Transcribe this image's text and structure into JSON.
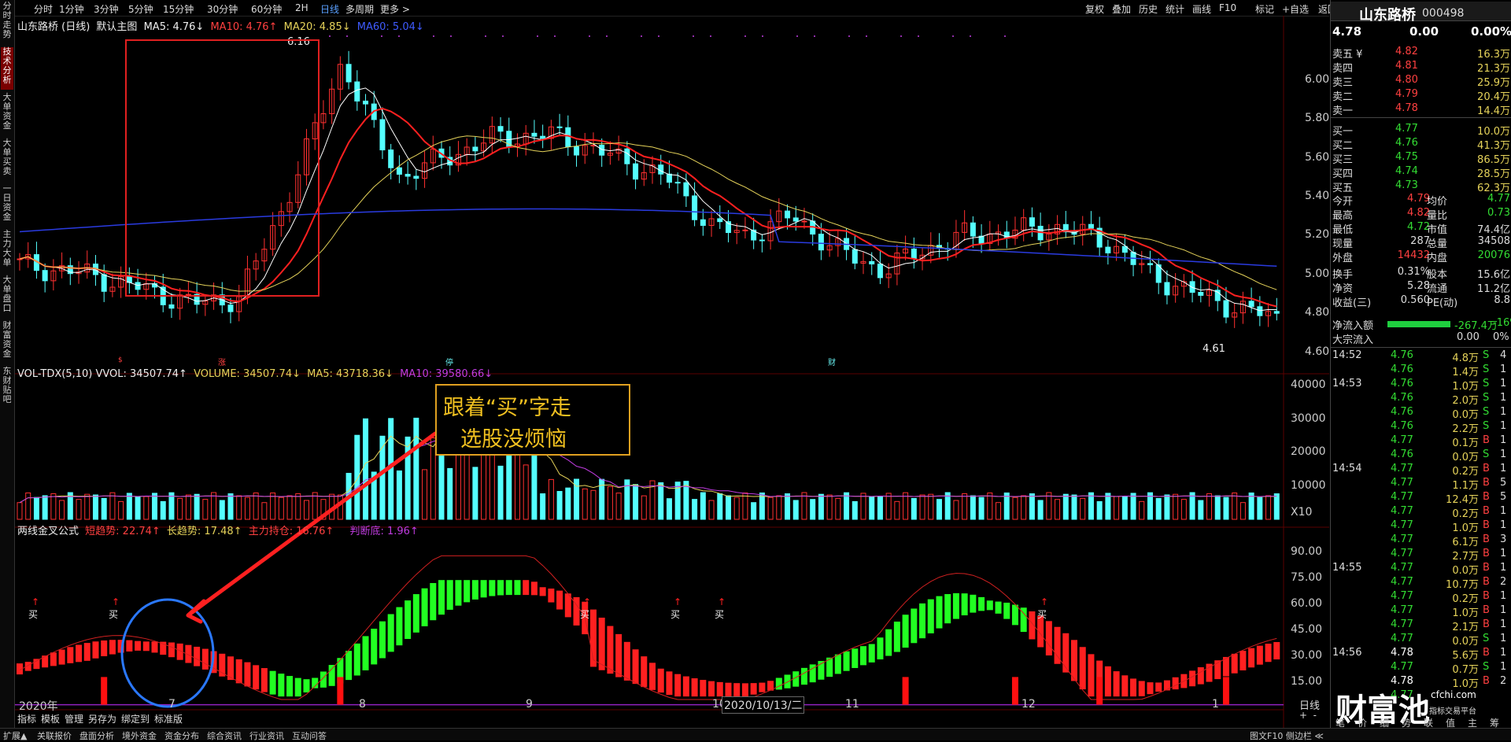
{
  "leftbar": [
    "分时走势",
    "技术分析",
    "大单资金",
    "大单买卖",
    "一日资金",
    "主力大单",
    "大单盘口",
    "财富资金",
    "东财贴吧"
  ],
  "toolbar_left": [
    "分时",
    "1分钟",
    "3分钟",
    "5分钟",
    "15分钟",
    "30分钟",
    "60分钟",
    "2H",
    "日线",
    "多周期",
    "更多 >"
  ],
  "toolbar_right": [
    "复权",
    "叠加",
    "历史",
    "统计",
    "画线",
    "F10",
    "标记",
    "+自选",
    "返回"
  ],
  "main_indicator": {
    "name": "山东路桥 (日线)",
    "preset": "默认主图",
    "ma5": "MA5: 4.76↓",
    "ma10": "MA10: 4.76↑",
    "ma20": "MA20: 4.85↓",
    "ma60": "MA60: 5.04↓"
  },
  "annotations": {
    "high": "6.16",
    "low": "4.61"
  },
  "event_marks": {
    "a": "$",
    "b": "涨",
    "c": "停",
    "d": "财"
  },
  "price_axis": [
    "6.00",
    "5.80",
    "5.60",
    "5.40",
    "5.20",
    "5.00",
    "4.80",
    "4.60"
  ],
  "vol_indicator": {
    "name": "VOL-TDX(5,10) VVOL: 34507.74↑",
    "volume": "VOLUME: 34507.74↓",
    "ma5": "MA5: 43718.36↓",
    "ma10": "MA10: 39580.66↓"
  },
  "vol_axis": [
    "40000",
    "30000",
    "20000",
    "10000",
    "X10"
  ],
  "promo_box": {
    "line1": "跟着“买”字走",
    "line2": "选股没烦恼"
  },
  "sub_indicator": {
    "name": "两线金叉公式",
    "short": "短趋势: 22.74↑",
    "long": "长趋势: 17.48↑",
    "main": "主力持仓: 16.76↑",
    "judge": "判断底: 1.96↑"
  },
  "sub_axis": [
    "90.00",
    "75.00",
    "60.00",
    "45.00",
    "30.00",
    "15.00"
  ],
  "buy_label": "买",
  "date_axis": [
    "2020年",
    "7",
    "8",
    "9",
    "10",
    "11",
    "12",
    "1"
  ],
  "cursor_date": "2020/10/13/二",
  "date_axis_right": "日线",
  "bottom_left": [
    "指标",
    "模板",
    "管理",
    "另存为",
    "绑定到",
    "标准版"
  ],
  "bottom_bar": [
    "扩展▲",
    "关联报价",
    "盘面分析",
    "境外资金",
    "资金分布",
    "综合资讯",
    "行业资讯",
    "互动问答"
  ],
  "bottom_right": "图文F10 侧边栏 ≪",
  "quote": {
    "name": "山东路桥",
    "code": "000498",
    "price": "4.78",
    "change": "0.00",
    "pct": "0.00%",
    "asks": [
      [
        "卖五 ¥",
        "4.82",
        "16.3万"
      ],
      [
        "卖四",
        "4.81",
        "21.3万"
      ],
      [
        "卖三",
        "4.80",
        "25.9万"
      ],
      [
        "卖二",
        "4.79",
        "20.4万"
      ],
      [
        "卖一",
        "4.78",
        "14.4万"
      ]
    ],
    "bids": [
      [
        "买一",
        "4.77",
        "10.0万"
      ],
      [
        "买二",
        "4.76",
        "41.3万"
      ],
      [
        "买三",
        "4.75",
        "86.5万"
      ],
      [
        "买四",
        "4.74",
        "28.5万"
      ],
      [
        "买五",
        "4.73",
        "62.3万"
      ]
    ],
    "stats": [
      [
        "今开",
        "4.79",
        "均价",
        "4.77"
      ],
      [
        "最高",
        "4.82",
        "量比",
        "0.73"
      ],
      [
        "最低",
        "4.72",
        "市值",
        "74.4亿"
      ],
      [
        "现量",
        "287",
        "总量",
        "34508"
      ],
      [
        "外盘",
        "14432",
        "内盘",
        "20076"
      ]
    ],
    "stats2": [
      [
        "换手",
        "0.31%",
        "股本",
        "15.6亿"
      ],
      [
        "净资",
        "5.28",
        "流通",
        "11.2亿"
      ],
      [
        "收益(三)",
        "0.560",
        "PE(动)",
        "8.8"
      ]
    ],
    "netflow": {
      "label": "净流入额",
      "value": "-267.4万",
      "pct": "-16%"
    },
    "block": {
      "label": "大宗流入",
      "value": "0.00",
      "pct": "0%"
    }
  },
  "ticks": [
    [
      "14:52",
      "4.76",
      "4.8万",
      "S",
      "4"
    ],
    [
      "",
      "4.76",
      "1.4万",
      "S",
      "1"
    ],
    [
      "14:53",
      "4.76",
      "1.0万",
      "S",
      "1"
    ],
    [
      "",
      "4.76",
      "2.0万",
      "S",
      "1"
    ],
    [
      "",
      "4.76",
      "0.0万",
      "S",
      "1"
    ],
    [
      "",
      "4.76",
      "2.2万",
      "S",
      "1"
    ],
    [
      "",
      "4.77",
      "0.1万",
      "B",
      "1"
    ],
    [
      "",
      "4.76",
      "0.0万",
      "S",
      "1"
    ],
    [
      "14:54",
      "4.77",
      "0.2万",
      "B",
      "1"
    ],
    [
      "",
      "4.77",
      "1.1万",
      "B",
      "5"
    ],
    [
      "",
      "4.77",
      "12.4万",
      "B",
      "5"
    ],
    [
      "",
      "4.77",
      "0.2万",
      "B",
      "1"
    ],
    [
      "",
      "4.77",
      "1.0万",
      "B",
      "1"
    ],
    [
      "",
      "4.77",
      "6.1万",
      "B",
      "3"
    ],
    [
      "",
      "4.77",
      "2.7万",
      "B",
      "1"
    ],
    [
      "14:55",
      "4.77",
      "0.0万",
      "B",
      "1"
    ],
    [
      "",
      "4.77",
      "10.7万",
      "B",
      "2"
    ],
    [
      "",
      "4.77",
      "0.2万",
      "B",
      "1"
    ],
    [
      "",
      "4.77",
      "1.0万",
      "B",
      "1"
    ],
    [
      "",
      "4.77",
      "2.1万",
      "B",
      "1"
    ],
    [
      "",
      "4.77",
      "0.0万",
      "S",
      "1"
    ],
    [
      "14:56",
      "4.78",
      "5.6万",
      "B",
      "1"
    ],
    [
      "",
      "4.77",
      "0.7万",
      "S",
      "1"
    ],
    [
      "",
      "4.78",
      "1.0万",
      "B",
      "2"
    ],
    [
      "",
      "4.77",
      "",
      "",
      ""
    ]
  ],
  "right_tabs": [
    "笔",
    "价",
    "细",
    "势",
    "联",
    "值",
    "主",
    "筹"
  ],
  "watermark": {
    "cn": "财富池",
    "en": "cfchi.com",
    "sub": "指标交易平台"
  },
  "chart_data": {
    "type": "line",
    "title": "山东路桥 (日线)",
    "price_range": [
      4.55,
      6.25
    ],
    "ma_last": {
      "MA5": 4.76,
      "MA10": 4.76,
      "MA20": 4.85,
      "MA60": 5.04
    },
    "high": 6.16,
    "low": 4.61,
    "volume_last": 34507.74,
    "vol_ma5": 43718.36,
    "vol_ma10": 39580.66,
    "sub_range": [
      0,
      100
    ],
    "sub_last": {
      "短趋势": 22.74,
      "长趋势": 17.48,
      "主力持仓": 16.76,
      "判断底": 1.96
    }
  }
}
